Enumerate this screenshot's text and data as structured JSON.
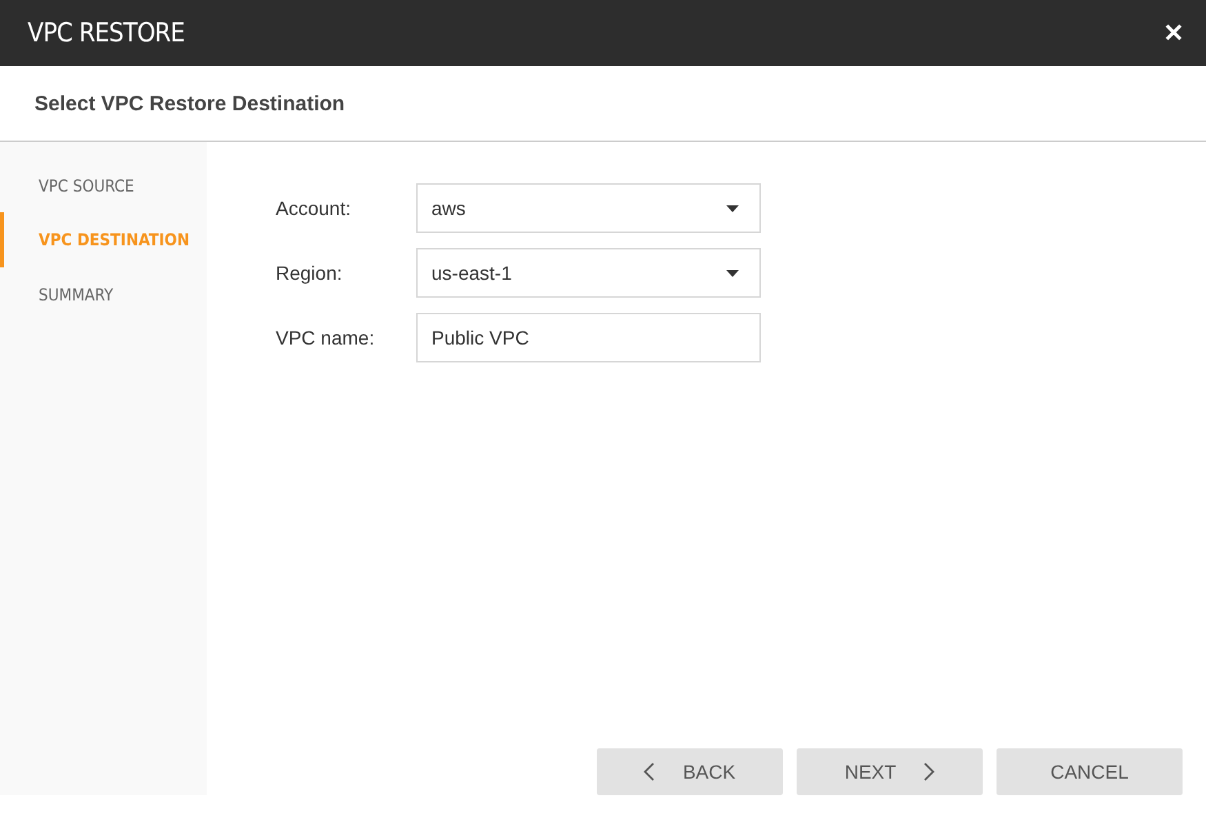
{
  "window": {
    "title": "VPC RESTORE",
    "close": "✕"
  },
  "subtitle": "Select VPC Restore Destination",
  "steps": [
    {
      "label": "VPC SOURCE",
      "selected": false
    },
    {
      "label": "VPC DESTINATION",
      "selected": true
    },
    {
      "label": "SUMMARY",
      "selected": false
    }
  ],
  "fields": [
    {
      "label": "Account:",
      "kind": "select",
      "value": "aws"
    },
    {
      "label": "Region:",
      "kind": "select",
      "value": "us-east-1"
    },
    {
      "label": "VPC name:",
      "kind": "text",
      "value": "Public VPC"
    }
  ],
  "buttons": [
    {
      "label": "BACK",
      "kind": "back"
    },
    {
      "label": "NEXT",
      "kind": "next"
    },
    {
      "label": "CANCEL",
      "kind": "plain"
    }
  ]
}
